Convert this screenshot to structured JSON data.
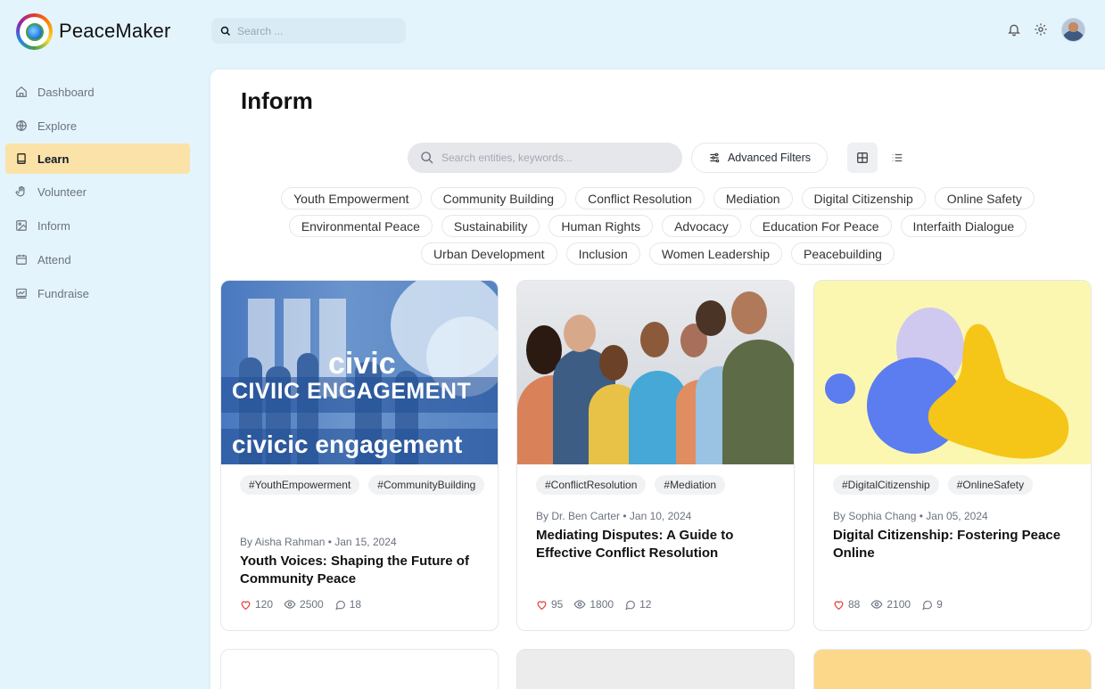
{
  "brand": {
    "name": "PeaceMaker"
  },
  "top_search": {
    "placeholder": "Search ..."
  },
  "sidebar": {
    "items": [
      {
        "label": "Dashboard",
        "icon": "home-icon"
      },
      {
        "label": "Explore",
        "icon": "globe-icon"
      },
      {
        "label": "Learn",
        "icon": "book-icon",
        "active": true
      },
      {
        "label": "Volunteer",
        "icon": "hand-icon"
      },
      {
        "label": "Inform",
        "icon": "image-icon"
      },
      {
        "label": "Attend",
        "icon": "calendar-icon"
      },
      {
        "label": "Fundraise",
        "icon": "chart-icon"
      }
    ]
  },
  "main": {
    "title": "Inform",
    "search_placeholder": "Search entities, keywords...",
    "advanced_filters_label": "Advanced Filters"
  },
  "tags": {
    "row1": [
      "Youth Empowerment",
      "Community Building",
      "Conflict Resolution",
      "Mediation",
      "Digital Citizenship",
      "Online Safety"
    ],
    "row2": [
      "Environmental Peace",
      "Sustainability",
      "Human Rights",
      "Advocacy",
      "Education For Peace",
      "Interfaith Dialogue"
    ],
    "row3": [
      "Urban Development",
      "Inclusion",
      "Women Leadership",
      "Peacebuilding"
    ]
  },
  "cards": [
    {
      "image_text": [
        "civic",
        "CIVIIC ENGAGEMENT",
        "civicic engagement"
      ],
      "tags": [
        "#YouthEmpowerment",
        "#CommunityBuilding"
      ],
      "meta": "By Aisha Rahman • Jan 15, 2024",
      "title": "Youth Voices: Shaping the Future of Community Peace",
      "likes": "120",
      "views": "2500",
      "comments": "18"
    },
    {
      "tags": [
        "#ConflictResolution",
        "#Mediation"
      ],
      "meta": "By Dr. Ben Carter • Jan 10, 2024",
      "title": "Mediating Disputes: A Guide to Effective Conflict Resolution",
      "likes": "95",
      "views": "1800",
      "comments": "12"
    },
    {
      "tags": [
        "#DigitalCitizenship",
        "#OnlineSafety"
      ],
      "meta": "By Sophia Chang • Jan 05, 2024",
      "title": "Digital Citizenship: Fostering Peace Online",
      "likes": "88",
      "views": "2100",
      "comments": "9"
    }
  ],
  "colors": {
    "page_bg": "#e4f4fc",
    "active_nav": "#fbe2a8",
    "heart": "#e53935",
    "card3_bg": "#fbf7b0",
    "card_bottom_3": "#fcd98a"
  }
}
